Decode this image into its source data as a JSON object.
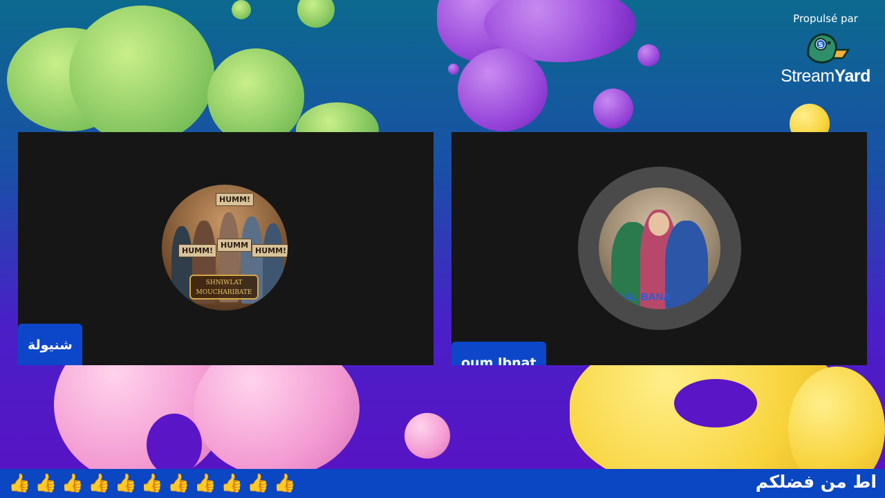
{
  "branding": {
    "powered_by": "Propulsé par",
    "name_light": "Stream",
    "name_bold": "Yard",
    "logo_icon": "duck-logo-icon"
  },
  "participants": [
    {
      "name": "شنيولة",
      "avatar": {
        "signs": [
          "HUMM!",
          "HUMM!",
          "HUMM",
          "HUMM!"
        ],
        "plaque": [
          "SHNIWLAT",
          "MOUCHARIBATE"
        ]
      }
    },
    {
      "name": "oum lbnat",
      "avatar": {
        "caption": "UM AL BANA"
      }
    }
  ],
  "ticker": {
    "emoji": "👍👍👍👍👍👍👍👍👍👍👍",
    "text": "اط من فضلكم"
  },
  "colors": {
    "label_bg": "#0d47c9",
    "ticker_bg": "#0b46c3",
    "tile_bg": "#161616"
  }
}
